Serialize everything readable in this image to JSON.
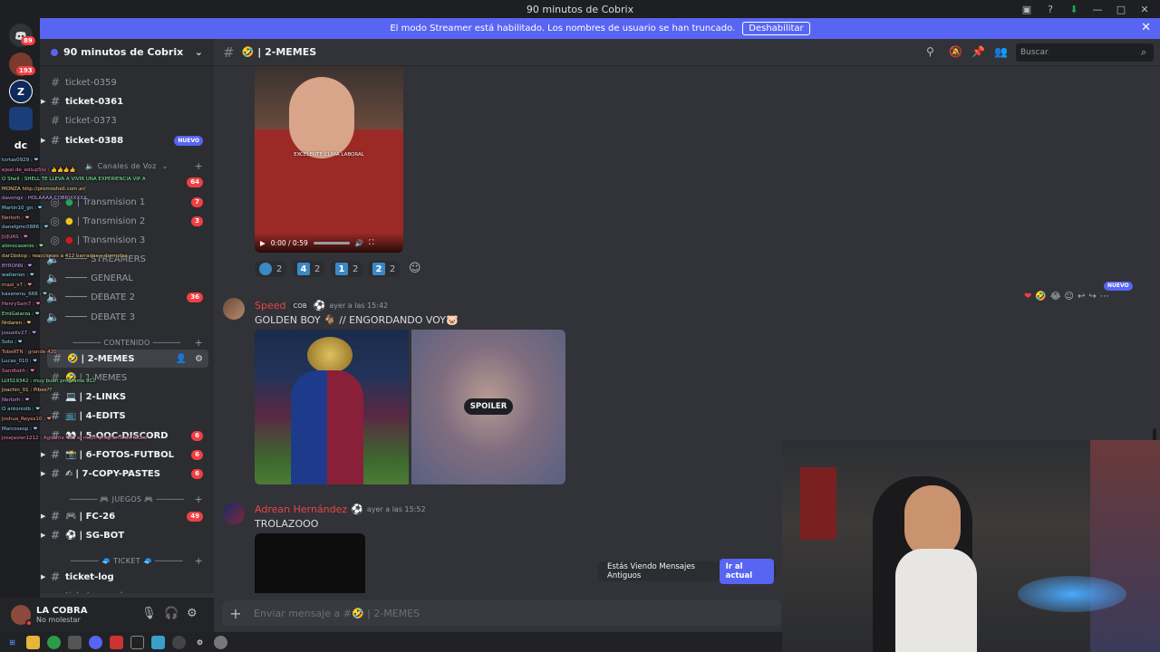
{
  "window": {
    "title": "90 minutos de Cobrix"
  },
  "banner": {
    "text": "El modo Streamer está habilitado. Los nombres de usuario se han truncado.",
    "button": "Deshabilitar"
  },
  "rail": {
    "badges": [
      "89",
      "193"
    ],
    "dc_label": "dc"
  },
  "server": {
    "name": "90 minutos de Cobrix"
  },
  "channels": {
    "top": [
      {
        "name": "ticket-0359",
        "bright": false
      },
      {
        "name": "ticket-0361",
        "bright": true
      },
      {
        "name": "ticket-0373",
        "bright": false
      },
      {
        "name": "ticket-0388",
        "bright": true,
        "tag": "NUEVO"
      }
    ],
    "voice_category": "Canales de Voz",
    "voice": [
      {
        "name": "| Transmision 1",
        "badge": "7"
      },
      {
        "name": "| Transmision 2",
        "badge": "3"
      },
      {
        "name": "| Transmision 3",
        "badge": ""
      },
      {
        "name": "STREAMERS",
        "badge": ""
      },
      {
        "name": "GENERAL",
        "badge": ""
      },
      {
        "name": "DEBATE 2",
        "badge": "36"
      },
      {
        "name": "DEBATE 3",
        "badge": ""
      }
    ],
    "voice_top_badge": "64",
    "content_category": "CONTENIDO",
    "content": [
      {
        "name": "| 2-MEMES",
        "selected": true,
        "badge": ""
      },
      {
        "name": "| 1-MEMES",
        "badge": ""
      },
      {
        "name": "| 2-LINKS",
        "badge": ""
      },
      {
        "name": "| 4-EDITS",
        "badge": ""
      },
      {
        "name": "| 5-OOC-DISCORD",
        "badge": "6"
      },
      {
        "name": "| 6-FOTOS-FUTBOL",
        "badge": "6"
      },
      {
        "name": "| 7-COPY-PASTES",
        "badge": "6"
      }
    ],
    "games_category": "JUEGOS",
    "games": [
      {
        "name": "| FC-26",
        "badge": "49"
      },
      {
        "name": "| SG-BOT",
        "badge": ""
      }
    ],
    "ticket_category": "TICKET",
    "tickets": [
      {
        "name": "ticket-log"
      },
      {
        "name": "ticket-cerrados"
      }
    ]
  },
  "user": {
    "name": "LA COBRA",
    "status": "No molestar"
  },
  "overlay_chat": [
    "tortas0929 : ❤",
    "ejeal.de_ediup5tv : 👍👍👍👍",
    "O Shell : SHELL TE LLEVA A VIVIR UNA EXPERIENCIA VIP A",
    "MONZA http://promoshell.com.ar/",
    "davongz : HOLAAAA COBRIXXXXX",
    "Martin10_gn : ❤",
    "Nerlorh : ❤",
    "danelgmc0886 : ❤",
    "JUJUAS : ❤",
    "alonscasenio : ❤",
    "dar1bstop : reacciones a 412 barradas y dormidas",
    "BYRONN : ❤",
    "walterion : ❤",
    "maxi_v7 : ❤",
    "kasanenu_666 : ❤",
    "HenrySam7 : ❤",
    "EmiGalarza : ❤",
    "Nrdaren : ❤",
    "josueliv27 : ❤",
    "Soto : ❤",
    "TobeRTN : grande 420",
    "Lucas_010 : ❤",
    "Sandtokh : ❤",
    "LUIS19342 : muy buen programa 912",
    "Joachin_01 : Pibes??",
    "Nerlorh : ❤",
    "O antoniolb : ❤",
    "Joshua_Reyes10 : ❤",
    "Marcosesp : ❤",
    "josejavier1212 : Aguante 412 el mejor programa de futbol"
  ],
  "channel_header": {
    "name": "| 2-MEMES",
    "search_placeholder": "Buscar"
  },
  "video": {
    "caption": "EXCELENTE CLIMA LABORAL",
    "time": "0:00 / 0:59"
  },
  "reactions": [
    {
      "emoji": "blue-face",
      "count": "2"
    },
    {
      "emoji": "4",
      "count": "2"
    },
    {
      "emoji": "1",
      "count": "2"
    },
    {
      "emoji": "2",
      "count": "2"
    }
  ],
  "messages": [
    {
      "author": "Speed",
      "tag": "COB",
      "time": "ayer a las 15:42",
      "text": "GOLDEN BOY 🐐 // ENGORDANDO VOY🐷",
      "spoiler_label": "SPOILER"
    },
    {
      "author": "Adrean Hernández",
      "time": "ayer a las 15:52",
      "text": "TROLAZOOO"
    }
  ],
  "new_tag": "NUEVO",
  "old_messages_bar": {
    "text": "Estás Viendo Mensajes Antiguos",
    "button": "Ir al actual"
  },
  "composer": {
    "placeholder": "Enviar mensaje a #🤣 | 2-MEMES"
  },
  "colors": {
    "accent": "#5865f2",
    "danger": "#f23f43",
    "author": "#ed4245"
  }
}
